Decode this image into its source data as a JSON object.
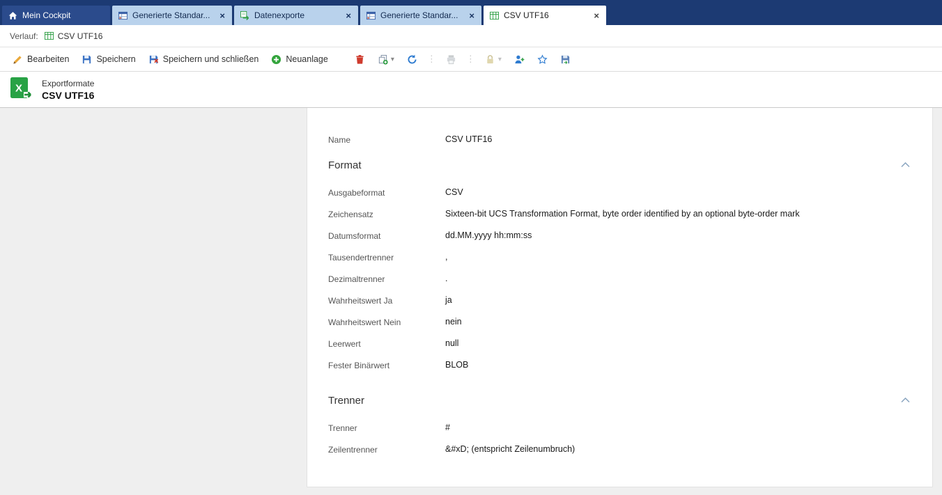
{
  "glyphs": {
    "close": "×",
    "caret": "▾",
    "separator": "⋮"
  },
  "tabs": [
    {
      "label": "Mein Cockpit"
    },
    {
      "label": "Generierte Standar..."
    },
    {
      "label": "Datenexporte"
    },
    {
      "label": "Generierte Standar..."
    },
    {
      "label": "CSV UTF16"
    }
  ],
  "history": {
    "label": "Verlauf:",
    "item": "CSV UTF16"
  },
  "toolbar": {
    "edit": "Bearbeiten",
    "save": "Speichern",
    "save_close": "Speichern und schließen",
    "new": "Neuanlage"
  },
  "header": {
    "category": "Exportformate",
    "title": "CSV UTF16"
  },
  "form": {
    "name_row": {
      "label": "Name",
      "value": "CSV UTF16"
    },
    "sections": [
      {
        "title": "Format",
        "rows": [
          {
            "label": "Ausgabeformat",
            "value": "CSV"
          },
          {
            "label": "Zeichensatz",
            "value": "Sixteen-bit UCS Transformation Format, byte order identified by an optional byte-order mark"
          },
          {
            "label": "Datumsformat",
            "value": "dd.MM.yyyy hh:mm:ss"
          },
          {
            "label": "Tausendertrenner",
            "value": ","
          },
          {
            "label": "Dezimaltrenner",
            "value": "."
          },
          {
            "label": "Wahrheitswert Ja",
            "value": "ja"
          },
          {
            "label": "Wahrheitswert Nein",
            "value": "nein"
          },
          {
            "label": "Leerwert",
            "value": "null"
          },
          {
            "label": "Fester Binärwert",
            "value": "BLOB"
          }
        ]
      },
      {
        "title": "Trenner",
        "rows": [
          {
            "label": "Trenner",
            "value": "#"
          },
          {
            "label": "Zeilentrenner",
            "value": "&#xD; (entspricht Zeilenumbruch)"
          }
        ]
      }
    ]
  }
}
